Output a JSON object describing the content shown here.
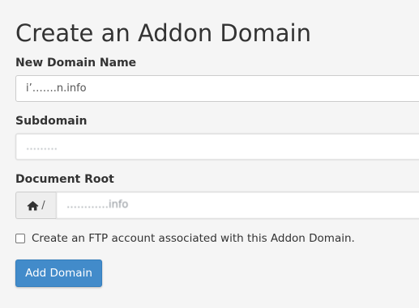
{
  "form": {
    "title": "Create an Addon Domain",
    "new_domain": {
      "label": "New Domain Name",
      "value": "i’…….n.info"
    },
    "subdomain": {
      "label": "Subdomain",
      "value": "………"
    },
    "document_root": {
      "label": "Document Root",
      "prefix": "/",
      "prefix_icon": "home-icon",
      "value": "…………info"
    },
    "ftp_checkbox": {
      "label": "Create an FTP account associated with this Addon Domain.",
      "checked": false
    },
    "submit_label": "Add Domain"
  },
  "colors": {
    "primary_button": "#428bca",
    "page_background": "#f5f5f5",
    "input_border": "#cccccc",
    "addon_background": "#eeeeee"
  }
}
